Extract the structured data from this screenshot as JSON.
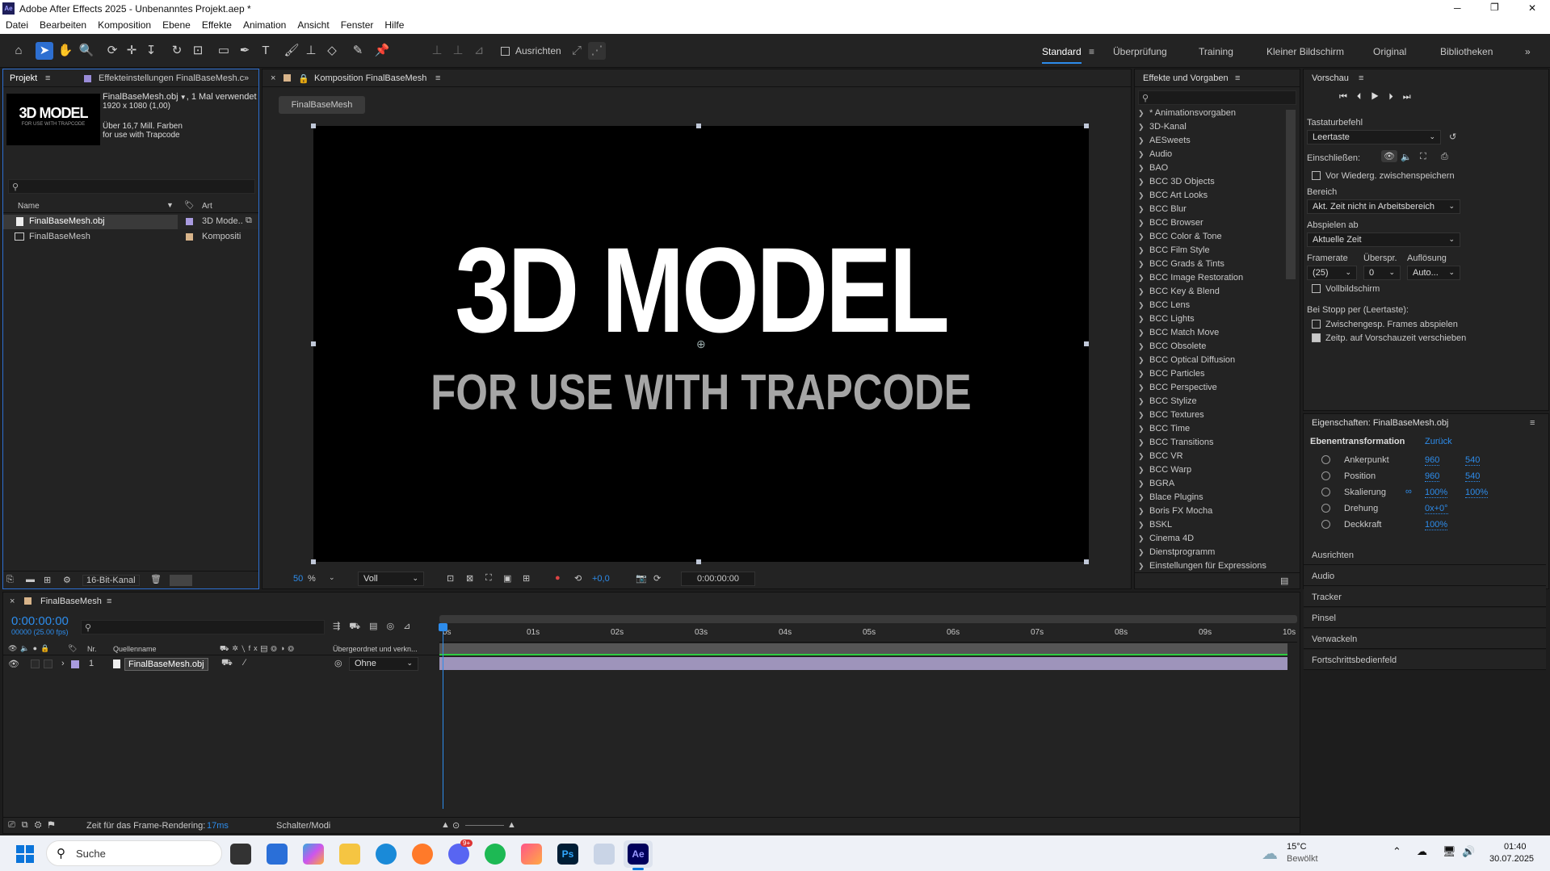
{
  "window": {
    "title": "Adobe After Effects 2025 - Unbenanntes Projekt.aep *",
    "app_badge": "Ae",
    "min": "─",
    "max": "❐",
    "close": "✕"
  },
  "menu": [
    "Datei",
    "Bearbeiten",
    "Komposition",
    "Ebene",
    "Effekte",
    "Animation",
    "Ansicht",
    "Fenster",
    "Hilfe"
  ],
  "toolbar": {
    "snap_label": "Ausrichten",
    "workspaces": [
      "Standard",
      "Überprüfung",
      "Training",
      "Kleiner Bildschirm",
      "Original",
      "Bibliotheken"
    ],
    "more": "»"
  },
  "project": {
    "tab": "Projekt",
    "tab2": "Effekteinstellungen FinalBaseMesh.c",
    "thumb_title": "3D MODEL",
    "thumb_sub": "FOR USE WITH TRAPCODE",
    "file_name": "FinalBaseMesh.obj",
    "used": ", 1 Mal verwendet",
    "dims": "1920 x 1080 (1,00)",
    "colors": "Über 16,7 Mill. Farben",
    "desc": "for use with Trapcode",
    "col_name": "Name",
    "col_type": "Art",
    "items": [
      {
        "name": "FinalBaseMesh.obj",
        "type": "3D Mode.."
      },
      {
        "name": "FinalBaseMesh",
        "type": "Kompositi"
      }
    ],
    "bit_depth": "16-Bit-Kanal"
  },
  "comp": {
    "tab": "Komposition FinalBaseMesh",
    "subtab": "FinalBaseMesh",
    "title_big": "3D MODEL",
    "title_sub": "FOR USE WITH TRAPCODE",
    "zoom": "50",
    "zoom_unit": "%",
    "quality": "Voll",
    "exposure": "+0,0",
    "timecode": "0:00:00:00"
  },
  "effects": {
    "title": "Effekte und Vorgaben",
    "items": [
      "* Animationsvorgaben",
      "3D-Kanal",
      "AESweets",
      "Audio",
      "BAO",
      "BCC 3D Objects",
      "BCC Art Looks",
      "BCC Blur",
      "BCC Browser",
      "BCC Color & Tone",
      "BCC Film Style",
      "BCC Grads & Tints",
      "BCC Image Restoration",
      "BCC Key & Blend",
      "BCC Lens",
      "BCC Lights",
      "BCC Match Move",
      "BCC Obsolete",
      "BCC Optical Diffusion",
      "BCC Particles",
      "BCC Perspective",
      "BCC Stylize",
      "BCC Textures",
      "BCC Time",
      "BCC Transitions",
      "BCC VR",
      "BCC Warp",
      "BGRA",
      "Blace Plugins",
      "Boris FX Mocha",
      "BSKL",
      "Cinema 4D",
      "Dienstprogramm",
      "Einstellungen für Expressions"
    ]
  },
  "preview": {
    "title": "Vorschau",
    "shortcut_label": "Tastaturbefehl",
    "shortcut": "Leertaste",
    "include_label": "Einschließen:",
    "cache_label": "Vor Wiederg. zwischenspeichern",
    "range_label": "Bereich",
    "range": "Akt. Zeit nicht in Arbeitsbereich",
    "play_from_label": "Abspielen ab",
    "play_from": "Aktuelle Zeit",
    "fps_label": "Framerate",
    "skip_label": "Überspr.",
    "res_label": "Auflösung",
    "fps": "(25)",
    "skip": "0",
    "res": "Auto...",
    "fullscreen": "Vollbildschirm",
    "on_stop": "Bei Stopp per (Leertaste):",
    "cached_frames": "Zwischengesp. Frames abspielen",
    "move_time": "Zeitp. auf Vorschauzeit verschieben"
  },
  "properties": {
    "title": "Eigenschaften: FinalBaseMesh.obj",
    "section": "Ebenentransformation",
    "reset": "Zurück",
    "rows": [
      {
        "name": "Ankerpunkt",
        "v1": "960",
        "v2": "540"
      },
      {
        "name": "Position",
        "v1": "960",
        "v2": "540"
      },
      {
        "name": "Skalierung",
        "v1": "100%",
        "v2": "100%"
      },
      {
        "name": "Drehung",
        "v1": "0x+0°",
        "v2": ""
      },
      {
        "name": "Deckkraft",
        "v1": "100%",
        "v2": ""
      }
    ],
    "panels": [
      "Ausrichten",
      "Audio",
      "Tracker",
      "Pinsel",
      "Verwackeln",
      "Fortschrittsbedienfeld"
    ]
  },
  "timeline": {
    "tab": "FinalBaseMesh",
    "time": "0:00:00:00",
    "fps": "00000 (25.00 fps)",
    "col_nr": "Nr.",
    "col_source": "Quellenname",
    "col_parent": "Übergeordnet und verkn...",
    "layer_nr": "1",
    "layer_name": "FinalBaseMesh.obj",
    "parent": "Ohne",
    "ticks": [
      "0s",
      "01s",
      "02s",
      "03s",
      "04s",
      "05s",
      "06s",
      "07s",
      "08s",
      "09s",
      "10s"
    ],
    "render_label": "Zeit für das Frame-Rendering:",
    "render_time": "17ms",
    "switches": "Schalter/Modi"
  },
  "taskbar": {
    "search": "Suche",
    "weather_temp": "15°C",
    "weather_desc": "Bewölkt",
    "time": "01:40",
    "date": "30.07.2025",
    "badge": "9+"
  }
}
